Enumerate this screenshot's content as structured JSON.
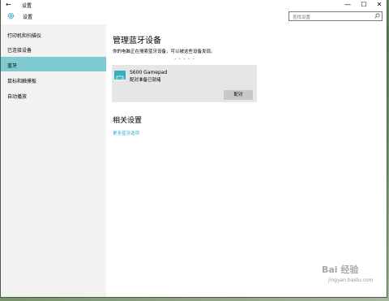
{
  "window": {
    "title": "设置",
    "controls": {
      "minimize": "—",
      "maximize": "☐",
      "close": "✕"
    }
  },
  "header": {
    "app_title": "设置",
    "search_placeholder": "查找设置"
  },
  "sidebar": {
    "items": [
      {
        "label": "打印机和扫描仪",
        "active": false
      },
      {
        "label": "已连接设备",
        "active": false
      },
      {
        "label": "蓝牙",
        "active": true
      },
      {
        "label": "鼠标和触摸板",
        "active": false
      },
      {
        "label": "自动播放",
        "active": false
      }
    ]
  },
  "main": {
    "title": "管理蓝牙设备",
    "description": "你的电脑正在搜索蓝牙设备，可以被这些设备发现。",
    "device": {
      "name": "S600 Gamepad",
      "status": "配对准备已就绪",
      "pair_label": "配对"
    },
    "related_title": "相关设置",
    "related_link": "更多蓝牙选项"
  },
  "watermark": {
    "logo": "Bai 经验",
    "url": "jingyan.baidu.com"
  },
  "colors": {
    "accent": "#80cbd1",
    "link": "#2fa8d6",
    "device_icon": "#36aebd"
  }
}
